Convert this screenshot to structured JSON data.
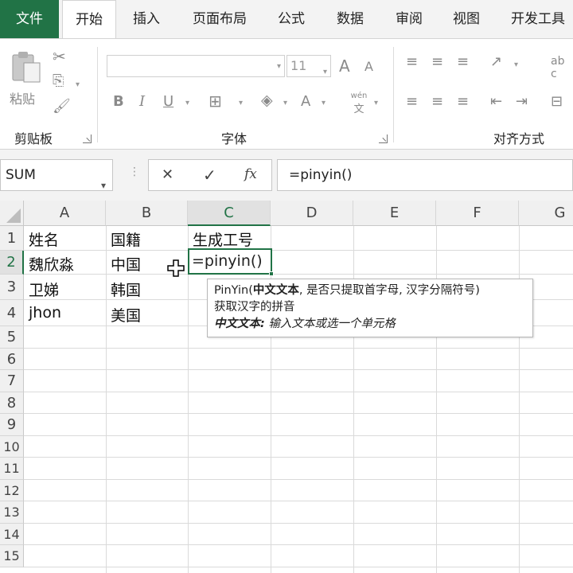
{
  "ribbon_tabs": [
    "文件",
    "开始",
    "插入",
    "页面布局",
    "公式",
    "数据",
    "审阅",
    "视图",
    "开发工具"
  ],
  "clipboard": {
    "paste_label": "粘贴",
    "group_label": "剪贴板"
  },
  "font": {
    "size": "11",
    "bold": "B",
    "italic": "I",
    "underline": "U",
    "font_color": "A",
    "phonetic_top": "wén",
    "phonetic_bottom": "文",
    "grow": "A",
    "shrink": "A",
    "group_label": "字体"
  },
  "alignment": {
    "group_label": "对齐方式",
    "wrap_top": "ab",
    "wrap_bottom": "c"
  },
  "formula_bar": {
    "name_box": "SUM",
    "cancel": "✕",
    "enter": "✓",
    "fx": "fx",
    "formula": "=pinyin()"
  },
  "columns": [
    "A",
    "B",
    "C",
    "D",
    "E",
    "F",
    "G"
  ],
  "rows": [
    "1",
    "2",
    "3",
    "4",
    "5",
    "6",
    "7",
    "8",
    "9",
    "10",
    "11",
    "12",
    "13",
    "14",
    "15"
  ],
  "cells": {
    "A1": "姓名",
    "B1": "国籍",
    "C1": "生成工号",
    "A2": "魏欣淼",
    "B2": "中国",
    "C2": "=pinyin()",
    "A3": "卫娣",
    "B3": "韩国",
    "A4": "jhon",
    "B4": "美国"
  },
  "tooltip": {
    "fn_name": "PinYin(",
    "arg1": "中文文本",
    "rest_args": ", 是否只提取首字母, 汉字分隔符号)",
    "description": "获取汉字的拼音",
    "arg_name": "中文文本:",
    "arg_desc": " 输入文本或选一个单元格"
  },
  "colors": {
    "accent": "#217346"
  }
}
